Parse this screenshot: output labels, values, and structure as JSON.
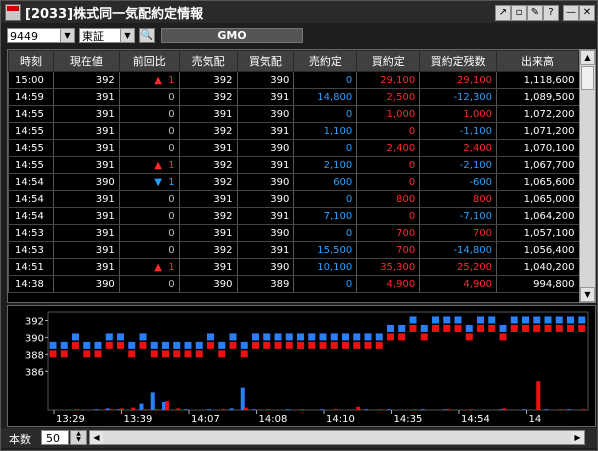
{
  "window": {
    "title": "[2033]株式同一気配約定情報"
  },
  "titlebar_buttons": [
    {
      "icon": "export-icon",
      "glyph": "↗"
    },
    {
      "icon": "window-icon",
      "glyph": "▫"
    },
    {
      "icon": "pin-icon",
      "glyph": "✎"
    },
    {
      "icon": "help-icon",
      "glyph": "?"
    },
    {
      "icon": "minimize-icon",
      "glyph": "—"
    },
    {
      "icon": "close-icon",
      "glyph": "✕"
    }
  ],
  "toolbar": {
    "code": "9449",
    "market": "東証",
    "search_icon": "search-icon",
    "search_glyph": "🔍",
    "name": "GMO"
  },
  "colors": {
    "up": "#ff2a2a",
    "down": "#2aa0ff",
    "neutral": "#ffffff",
    "zero": "#bbbbbb",
    "header_bg": "#404040"
  },
  "columns": [
    "時刻",
    "現在値",
    "前回比",
    "売気配",
    "買気配",
    "売約定",
    "買約定",
    "買約定残数",
    "出来高"
  ],
  "rows": [
    {
      "time": "15:00",
      "price": "392",
      "dir": "up",
      "change": "1",
      "ask": "392",
      "bid": "390",
      "sell": "0",
      "buy": "29,100",
      "net": "29,100",
      "vol": "1,118,600"
    },
    {
      "time": "14:59",
      "price": "391",
      "dir": "",
      "change": "0",
      "ask": "392",
      "bid": "391",
      "sell": "14,800",
      "buy": "2,500",
      "net": "-12,300",
      "vol": "1,089,500"
    },
    {
      "time": "14:55",
      "price": "391",
      "dir": "",
      "change": "0",
      "ask": "391",
      "bid": "390",
      "sell": "0",
      "buy": "1,000",
      "net": "1,000",
      "vol": "1,072,200"
    },
    {
      "time": "14:55",
      "price": "391",
      "dir": "",
      "change": "0",
      "ask": "392",
      "bid": "391",
      "sell": "1,100",
      "buy": "0",
      "net": "-1,100",
      "vol": "1,071,200"
    },
    {
      "time": "14:55",
      "price": "391",
      "dir": "",
      "change": "0",
      "ask": "391",
      "bid": "390",
      "sell": "0",
      "buy": "2,400",
      "net": "2,400",
      "vol": "1,070,100"
    },
    {
      "time": "14:55",
      "price": "391",
      "dir": "up",
      "change": "1",
      "ask": "392",
      "bid": "391",
      "sell": "2,100",
      "buy": "0",
      "net": "-2,100",
      "vol": "1,067,700"
    },
    {
      "time": "14:54",
      "price": "390",
      "dir": "down",
      "change": "1",
      "ask": "392",
      "bid": "390",
      "sell": "600",
      "buy": "0",
      "net": "-600",
      "vol": "1,065,600"
    },
    {
      "time": "14:54",
      "price": "391",
      "dir": "",
      "change": "0",
      "ask": "391",
      "bid": "390",
      "sell": "0",
      "buy": "800",
      "net": "800",
      "vol": "1,065,000"
    },
    {
      "time": "14:54",
      "price": "391",
      "dir": "",
      "change": "0",
      "ask": "392",
      "bid": "391",
      "sell": "7,100",
      "buy": "0",
      "net": "-7,100",
      "vol": "1,064,200"
    },
    {
      "time": "14:53",
      "price": "391",
      "dir": "",
      "change": "0",
      "ask": "391",
      "bid": "390",
      "sell": "0",
      "buy": "700",
      "net": "700",
      "vol": "1,057,100"
    },
    {
      "time": "14:53",
      "price": "391",
      "dir": "",
      "change": "0",
      "ask": "392",
      "bid": "391",
      "sell": "15,500",
      "buy": "700",
      "net": "-14,800",
      "vol": "1,056,400"
    },
    {
      "time": "14:51",
      "price": "391",
      "dir": "up",
      "change": "1",
      "ask": "391",
      "bid": "390",
      "sell": "10,100",
      "buy": "35,300",
      "net": "25,200",
      "vol": "1,040,200"
    },
    {
      "time": "14:38",
      "price": "390",
      "dir": "",
      "change": "0",
      "ask": "390",
      "bid": "389",
      "sell": "0",
      "buy": "4,900",
      "net": "4,900",
      "vol": "994,800"
    }
  ],
  "scroll_glyphs": {
    "up": "▲",
    "down": "▼",
    "left": "◀",
    "right": "▶"
  },
  "chart_data": {
    "type": "scatter",
    "ylim": [
      384.5,
      393
    ],
    "yticks": [
      "392",
      "390",
      "388",
      "386"
    ],
    "xticks": [
      "13:29",
      "13:39",
      "14:07",
      "14:08",
      "14:10",
      "14:35",
      "14:54",
      "14"
    ],
    "ask_series": [
      {
        "name": "",
        "color": "#2a7fff"
      }
    ],
    "bid_series": [
      {
        "name": "",
        "color": "#ee1111"
      }
    ],
    "ask": [
      389,
      389,
      390,
      389,
      389,
      390,
      390,
      389,
      390,
      389,
      389,
      389,
      389,
      389,
      390,
      389,
      390,
      389,
      390,
      390,
      390,
      390,
      390,
      390,
      390,
      390,
      390,
      390,
      390,
      390,
      391,
      391,
      392,
      391,
      392,
      392,
      392,
      391,
      392,
      392,
      391,
      392,
      392,
      392,
      392,
      392,
      392,
      392
    ],
    "bid": [
      388,
      388,
      389,
      388,
      388,
      389,
      389,
      388,
      389,
      388,
      388,
      388,
      388,
      388,
      389,
      388,
      389,
      388,
      389,
      389,
      389,
      389,
      389,
      389,
      389,
      389,
      389,
      389,
      389,
      389,
      390,
      390,
      391,
      390,
      391,
      391,
      391,
      390,
      391,
      391,
      390,
      391,
      391,
      391,
      391,
      391,
      391,
      391
    ],
    "volume_ask": [
      0,
      0,
      0,
      0,
      1,
      2,
      1,
      0,
      8,
      22,
      10,
      0,
      1,
      0,
      1,
      0,
      2,
      28,
      1,
      0,
      0,
      1,
      0,
      0,
      1,
      0,
      0,
      0,
      1,
      0,
      1,
      0,
      0,
      1,
      0,
      1,
      0,
      0,
      0,
      0,
      1,
      0,
      1,
      0,
      1,
      0,
      1,
      0
    ],
    "volume_buy": [
      0,
      0,
      1,
      0,
      0,
      1,
      2,
      3,
      1,
      1,
      11,
      2,
      0,
      0,
      0,
      1,
      0,
      3,
      0,
      1,
      0,
      0,
      1,
      0,
      0,
      1,
      0,
      4,
      0,
      1,
      0,
      0,
      1,
      0,
      0,
      1,
      0,
      1,
      0,
      0,
      2,
      0,
      0,
      36,
      0,
      1,
      0,
      1
    ]
  },
  "bottom": {
    "count_label": "本数",
    "count_value": "50"
  }
}
